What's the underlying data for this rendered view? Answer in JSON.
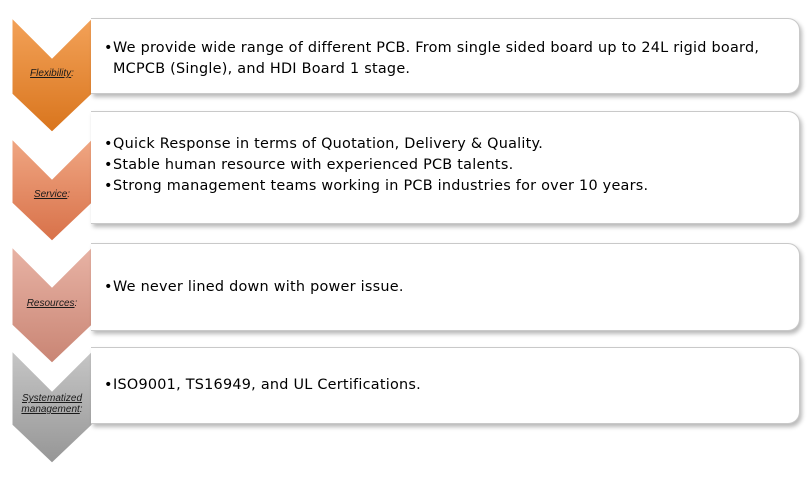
{
  "rows": [
    {
      "label_lines": [
        "Flexibility",
        ":"
      ],
      "color_top": "#f3a259",
      "color_bottom": "#d9751d",
      "bullets": [
        "We provide wide range of different PCB. From single sided board up to 24L rigid board, MCPCB (Single), and HDI Board 1 stage."
      ]
    },
    {
      "label_lines": [
        "Service",
        ":"
      ],
      "color_top": "#f0a783",
      "color_bottom": "#d87149",
      "bullets": [
        "Quick Response in terms of  Quotation, Delivery & Quality.",
        "Stable human resource with experienced PCB talents.",
        "Strong management teams working in PCB industries for over 10 years."
      ]
    },
    {
      "label_lines": [
        "Resources",
        ":"
      ],
      "color_top": "#e8b3a5",
      "color_bottom": "#c98574",
      "bullets": [
        "We never lined down with power issue."
      ]
    },
    {
      "label_lines": [
        "Systematized",
        "management",
        ":"
      ],
      "color_top": "#c6c6c6",
      "color_bottom": "#969696",
      "bullets": [
        "ISO9001, TS16949,  and UL Certifications."
      ]
    }
  ]
}
